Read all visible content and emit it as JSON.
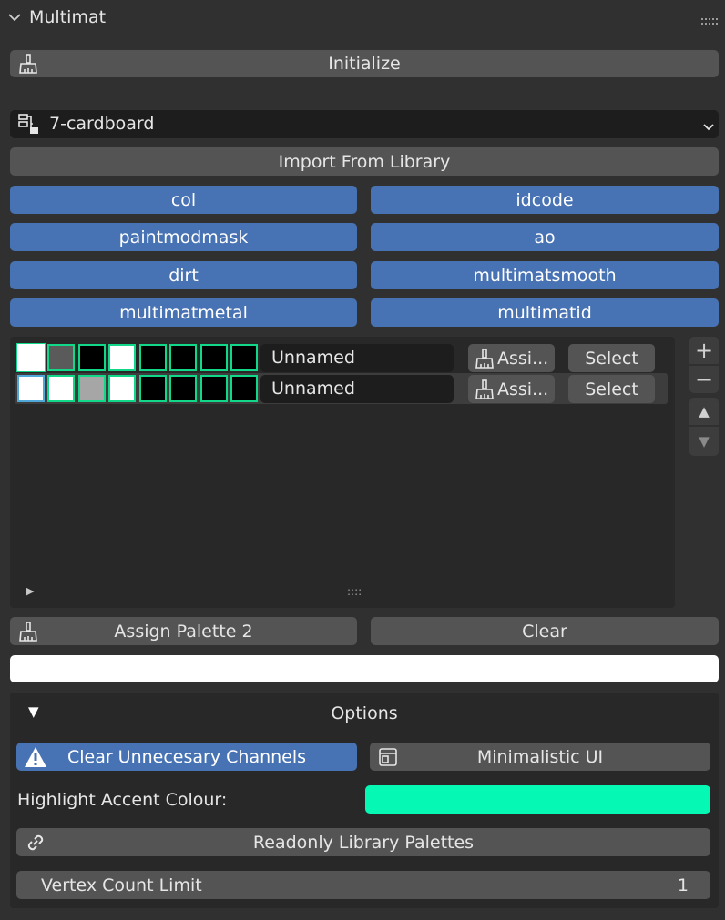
{
  "panel": {
    "title": "Multimat"
  },
  "initialize_label": "Initialize",
  "material": {
    "selected": "7-cardboard"
  },
  "import_label": "Import From Library",
  "channels": [
    {
      "label": "col"
    },
    {
      "label": "idcode"
    },
    {
      "label": "paintmodmask"
    },
    {
      "label": "ao"
    },
    {
      "label": "dirt"
    },
    {
      "label": "multimatsmooth"
    },
    {
      "label": "multimatmetal"
    },
    {
      "label": "multimatid"
    }
  ],
  "palettes": [
    {
      "name": "Unnamed",
      "assign_label": "Assi...",
      "select_label": "Select",
      "swatch_colors": [
        "#ffffff",
        "#5a5a5a",
        "#000000",
        "#ffffff",
        "#000000",
        "#000000",
        "#000000",
        "#000000"
      ]
    },
    {
      "name": "Unnamed",
      "assign_label": "Assi...",
      "select_label": "Select",
      "swatch_colors": [
        "#ffffff",
        "#ffffff",
        "#a6a6a6",
        "#ffffff",
        "#000000",
        "#000000",
        "#000000",
        "#000000"
      ]
    }
  ],
  "side_buttons": {
    "add": "+",
    "remove": "−",
    "move_up": "▲",
    "move_down": "▼"
  },
  "list_footer": {
    "expand": "▶",
    "grip": "::::"
  },
  "assign_palette_label": "Assign Palette 2",
  "clear_label": "Clear",
  "options": {
    "title": "Options",
    "toggle": "▼",
    "clear_channels_label": "Clear Unnecesary Channels",
    "minimalistic_label": "Minimalistic UI",
    "highlight_label": "Highlight Accent Colour:",
    "highlight_color": "#06f9b4",
    "readonly_label": "Readonly Library Palettes",
    "vertex_limit_label": "Vertex Count Limit",
    "vertex_limit_value": "1"
  },
  "colors": {
    "accent_blue": "#4772b3",
    "swatch_border": "#10d888"
  }
}
